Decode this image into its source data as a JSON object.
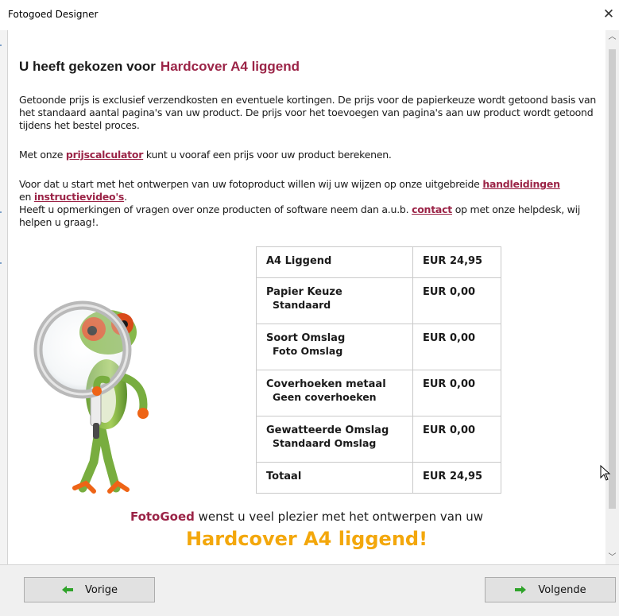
{
  "window": {
    "title": "Fotogoed Designer",
    "close_glyph": "✕"
  },
  "heading": {
    "prefix": "U heeft gekozen voor",
    "product": "Hardcover A4 liggend"
  },
  "intro": {
    "text": "Getoonde prijs is exclusief verzendkosten en eventuele kortingen. De prijs voor de  papierkeuze wordt getoond basis van het standaard aantal pagina's van uw product. De prijs voor het toevoegen van pagina's aan uw product wordt getoond tijdens het bestel proces."
  },
  "calculator": {
    "before": "Met onze ",
    "link": "prijscalculator",
    "after": " kunt u vooraf een prijs voor uw product berekenen."
  },
  "help": {
    "text1": "Voor dat u start met het ontwerpen van uw fotoproduct willen wij uw wijzen op onze uitgebreide ",
    "link_manuals": "handleidingen",
    "text2": "en ",
    "link_videos": "instructievideo's",
    "text3": ".",
    "text4": "Heeft u opmerkingen of vragen over onze producten of software neem dan a.u.b. ",
    "link_contact": "contact",
    "text5": " op met onze helpdesk, wij helpen u graag!."
  },
  "price_table": {
    "rows": [
      {
        "label": "A4 Liggend",
        "sub": "",
        "amount": "EUR 24,95"
      },
      {
        "label": "Papier Keuze",
        "sub": "Standaard",
        "amount": "EUR 0,00"
      },
      {
        "label": "Soort Omslag",
        "sub": "Foto Omslag",
        "amount": "EUR 0,00"
      },
      {
        "label": "Coverhoeken metaal",
        "sub": "Geen coverhoeken",
        "amount": "EUR 0,00"
      },
      {
        "label": "Gewatteerde Omslag",
        "sub": "Standaard Omslag",
        "amount": "EUR 0,00"
      },
      {
        "label": "Totaal",
        "sub": "",
        "amount": "EUR 24,95"
      }
    ]
  },
  "closing": {
    "brand": "FotoGoed",
    "text": " wenst u veel plezier met het ontwerpen van uw",
    "product_line": "Hardcover A4 liggend!"
  },
  "buttons": {
    "prev_label": "Vorige",
    "next_label": "Volgende"
  },
  "colors": {
    "accent": "#9b2447",
    "highlight": "#f3a70b",
    "arrow_green": "#2fa32a"
  },
  "icons": {
    "prev": "arrow-left-icon",
    "next": "arrow-right-icon",
    "illustration": "frog-magnifier-illustration"
  }
}
